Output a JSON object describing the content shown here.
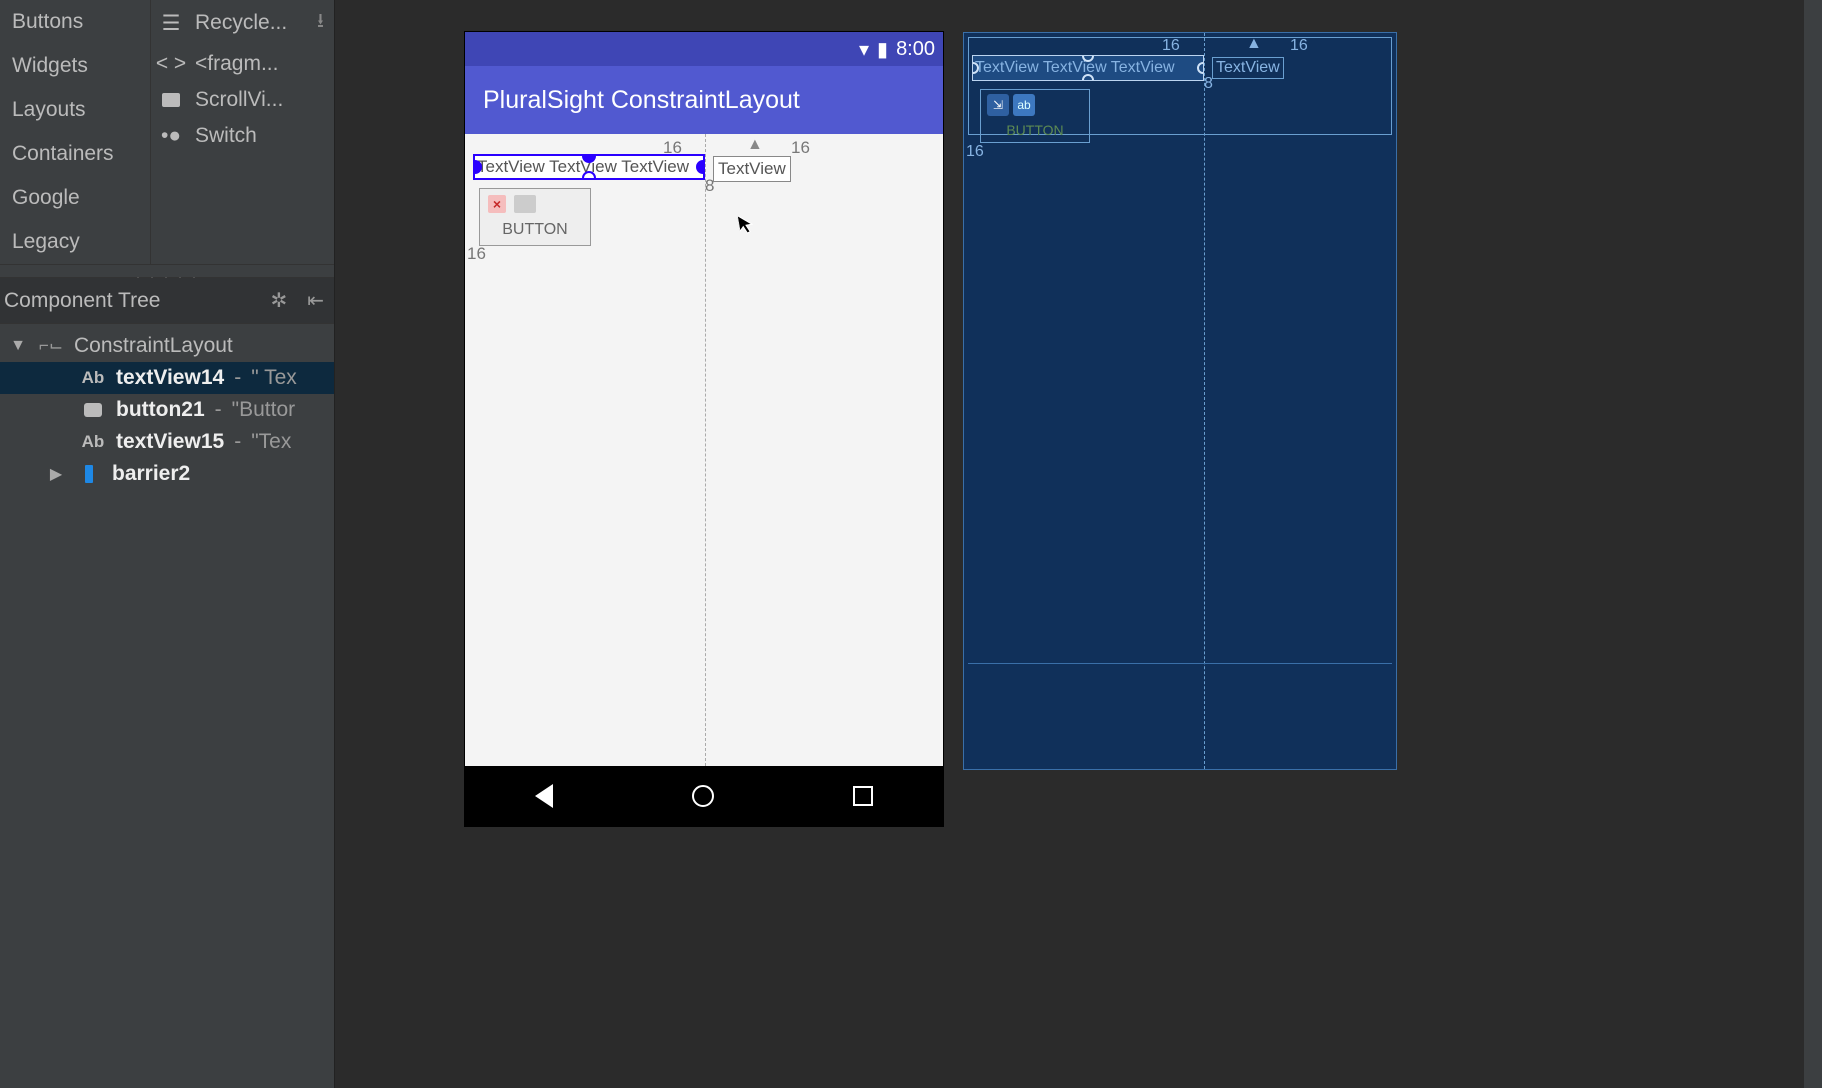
{
  "palette": {
    "categories": [
      "Buttons",
      "Widgets",
      "Layouts",
      "Containers",
      "Google",
      "Legacy"
    ],
    "items": [
      {
        "label": "Recycle...",
        "icon": "list",
        "download": true
      },
      {
        "label": "<fragm...",
        "icon": "angle",
        "download": false
      },
      {
        "label": "ScrollVi...",
        "icon": "rect",
        "download": false
      },
      {
        "label": "Switch",
        "icon": "switch",
        "download": false
      }
    ]
  },
  "componentTree": {
    "title": "Component Tree",
    "root": {
      "id": "ConstraintLayout"
    },
    "children": [
      {
        "id": "textView14",
        "type": "Ab",
        "value": "\" Tex",
        "selected": true
      },
      {
        "id": "button21",
        "type": "button",
        "value": "\"Buttor"
      },
      {
        "id": "textView15",
        "type": "Ab",
        "value": "\"Tex"
      },
      {
        "id": "barrier2",
        "type": "barrier",
        "expandable": true
      }
    ]
  },
  "device": {
    "statusTime": "8:00",
    "appTitle": "PluralSight ConstraintLayout",
    "tv14Text": "TextView TextView TextView",
    "tv15Text": "TextView",
    "btnText": "BUTTON",
    "margins": {
      "top1": "16",
      "top2": "16",
      "right": "8",
      "left": "16"
    }
  },
  "blueprint": {
    "tvText": "TextView TextView TextView",
    "tv15Text": "TextView",
    "btnText": "BUTTON",
    "margins": {
      "top1": "16",
      "top2": "16",
      "right": "8",
      "left": "16"
    }
  }
}
